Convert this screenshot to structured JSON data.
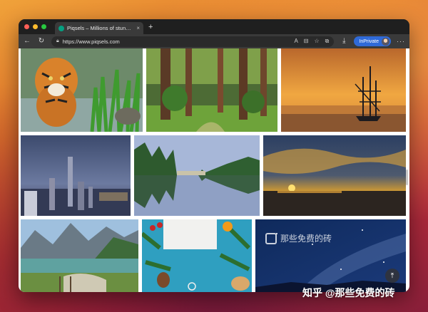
{
  "browser": {
    "tab_title": "Piqsels – Millions of stunning free images",
    "tab_close": "×",
    "new_tab": "+",
    "url": "https://www.piqsels.com",
    "inprivate_label": "InPrivate",
    "more_label": "···"
  },
  "icons": {
    "back": "←",
    "refresh": "↻",
    "lock": "🔒︎",
    "read_aloud": "A",
    "split": "⊟",
    "favorite": "☆",
    "collections": "⧉",
    "download": "⤓",
    "back_to_top": "⤒"
  },
  "watermark": {
    "inner_text": "那些免费的砖",
    "zhihu_text": "知乎 @那些免费的砖"
  },
  "photos": [
    {
      "subject": "tiger in water"
    },
    {
      "subject": "forest path"
    },
    {
      "subject": "sailing ship at sunset"
    },
    {
      "subject": "city skyline at dusk"
    },
    {
      "subject": "lake reflection with trees"
    },
    {
      "subject": "sunset over sea with clouds"
    },
    {
      "subject": "mountain lake valley"
    },
    {
      "subject": "christmas flat lay"
    },
    {
      "subject": "milky way night sky"
    }
  ]
}
